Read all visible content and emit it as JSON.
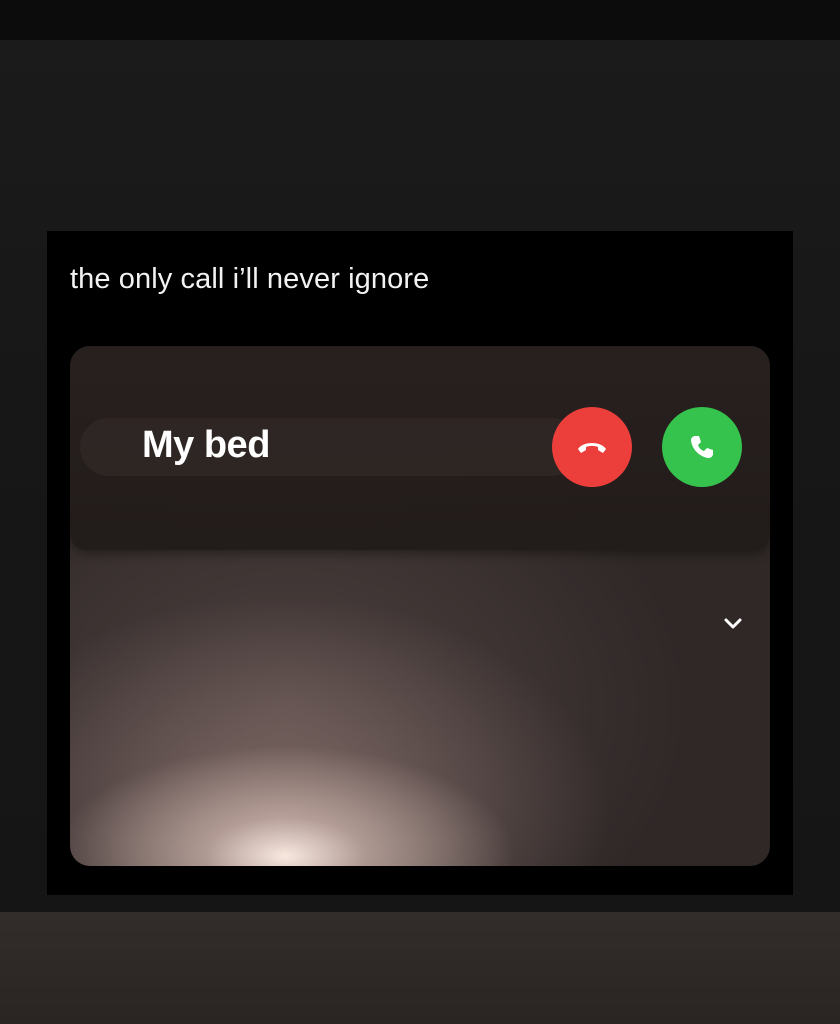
{
  "post": {
    "caption": "the only call i’ll never ignore"
  },
  "incoming_call": {
    "caller_name": "My bed",
    "decline_color": "#ec3f3b",
    "accept_color": "#35c34d",
    "decline_icon": "phone-hangup-icon",
    "accept_icon": "phone-icon"
  },
  "expand_icon": "chevron-down-icon"
}
